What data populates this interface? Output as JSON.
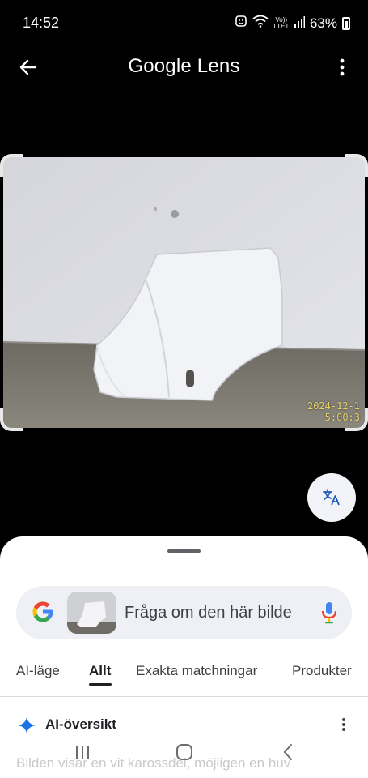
{
  "status_bar": {
    "time": "14:52",
    "network_top": "Vo))",
    "network_bottom": "LTE1",
    "battery": "63%"
  },
  "app_bar": {
    "title": "Google Lens"
  },
  "photo": {
    "stamp_line1": "2024-12-1",
    "stamp_line2": "5:00:3"
  },
  "search": {
    "query": "Fråga om den här bilde"
  },
  "tabs": [
    {
      "label": "AI-läge"
    },
    {
      "label": "Allt"
    },
    {
      "label": "Exakta matchningar"
    },
    {
      "label": "Produkter"
    }
  ],
  "active_tab": "Allt",
  "ai_overview": {
    "title": "AI-översikt",
    "summary": "Bilden visar en vit karossdel, möjligen en huv"
  },
  "icons": {
    "back": "arrow-left-icon",
    "menu": "more-vert-icon",
    "translate": "translate-icon",
    "mic": "mic-icon",
    "ai": "sparkle-icon"
  },
  "colors": {
    "google_blue": "#4285F4",
    "google_red": "#EA4335",
    "google_yellow": "#FBBC05",
    "google_green": "#34A853",
    "sheet_bg": "#FFFFFF",
    "search_bg": "#EEF0F5"
  }
}
